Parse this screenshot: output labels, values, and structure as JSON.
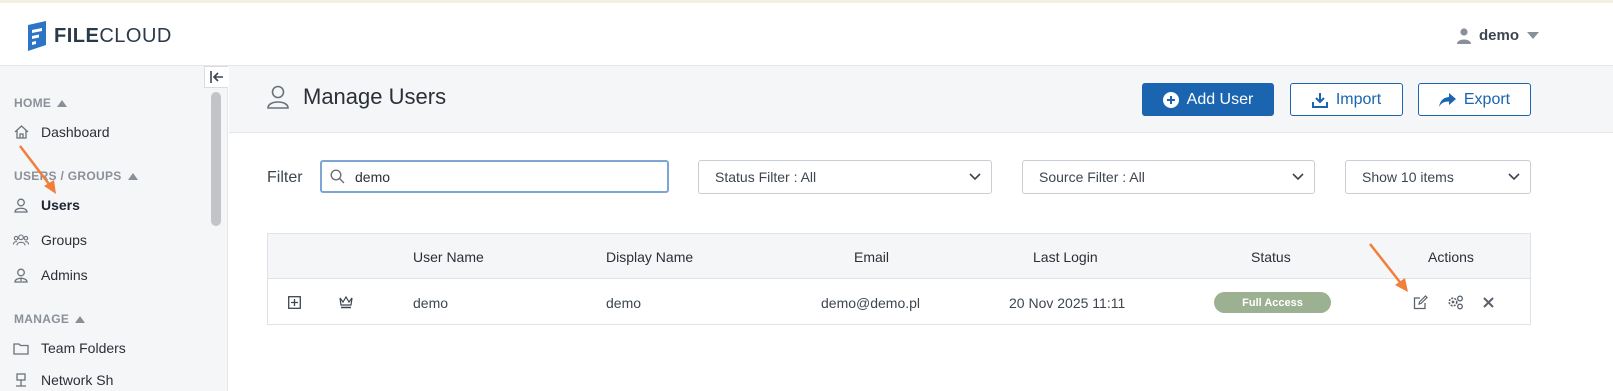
{
  "header": {
    "logo_prefix": "FILE",
    "logo_suffix": "CLOUD",
    "user_name": "demo"
  },
  "sidebar": {
    "sections": [
      {
        "label": "HOME",
        "items": [
          {
            "label": "Dashboard",
            "icon": "home-icon"
          }
        ]
      },
      {
        "label": "USERS / GROUPS",
        "items": [
          {
            "label": "Users",
            "icon": "user-icon",
            "active": true
          },
          {
            "label": "Groups",
            "icon": "group-icon"
          },
          {
            "label": "Admins",
            "icon": "admin-icon"
          }
        ]
      },
      {
        "label": "MANAGE",
        "items": [
          {
            "label": "Team Folders",
            "icon": "folder-icon"
          },
          {
            "label": "Network Sh",
            "icon": "network-share-icon"
          }
        ]
      }
    ]
  },
  "page": {
    "title": "Manage Users",
    "add_user_label": "Add User",
    "import_label": "Import",
    "export_label": "Export"
  },
  "filters": {
    "filter_label": "Filter",
    "search_value": "demo",
    "status_filter": "Status Filter : All",
    "source_filter": "Source Filter : All",
    "page_size": "Show 10 items"
  },
  "table": {
    "columns": [
      "User Name",
      "Display Name",
      "Email",
      "Last Login",
      "Status",
      "Actions"
    ],
    "rows": [
      {
        "user_name": "demo",
        "display_name": "demo",
        "email": "demo@demo.pl",
        "last_login": "20 Nov 2025 11:11",
        "status": "Full Access"
      }
    ]
  },
  "colors": {
    "primary": "#1a64b0",
    "badge": "#9bb191",
    "annotation_arrow": "#f07f3c"
  }
}
